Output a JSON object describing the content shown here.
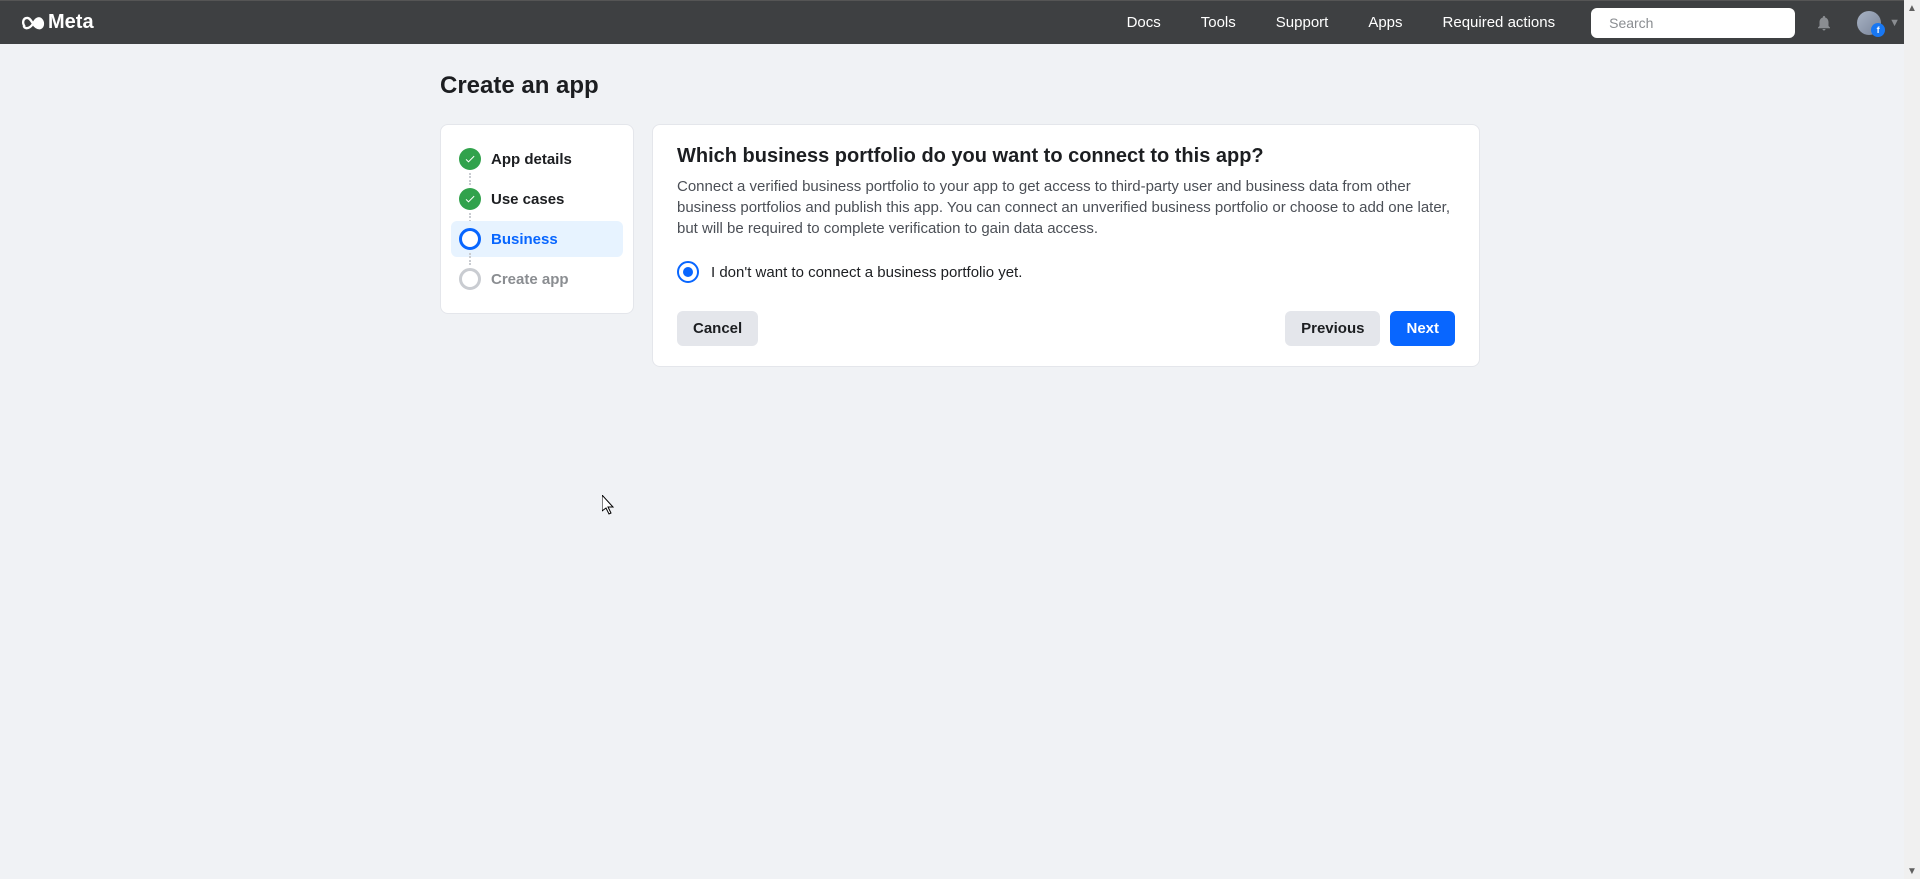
{
  "brand": "Meta",
  "nav": {
    "docs": "Docs",
    "tools": "Tools",
    "support": "Support",
    "apps": "Apps",
    "required_actions": "Required actions"
  },
  "search": {
    "placeholder": "Search"
  },
  "page": {
    "title": "Create an app"
  },
  "steps": {
    "app_details": "App details",
    "use_cases": "Use cases",
    "business": "Business",
    "create_app": "Create app"
  },
  "card": {
    "title": "Which business portfolio do you want to connect to this app?",
    "description": "Connect a verified business portfolio to your app to get access to third-party user and business data from other business portfolios and publish this app. You can connect an unverified business portfolio or choose to add one later, but will be required to complete verification to gain data access.",
    "option_none": "I don't want to connect a business portfolio yet."
  },
  "buttons": {
    "cancel": "Cancel",
    "previous": "Previous",
    "next": "Next"
  }
}
